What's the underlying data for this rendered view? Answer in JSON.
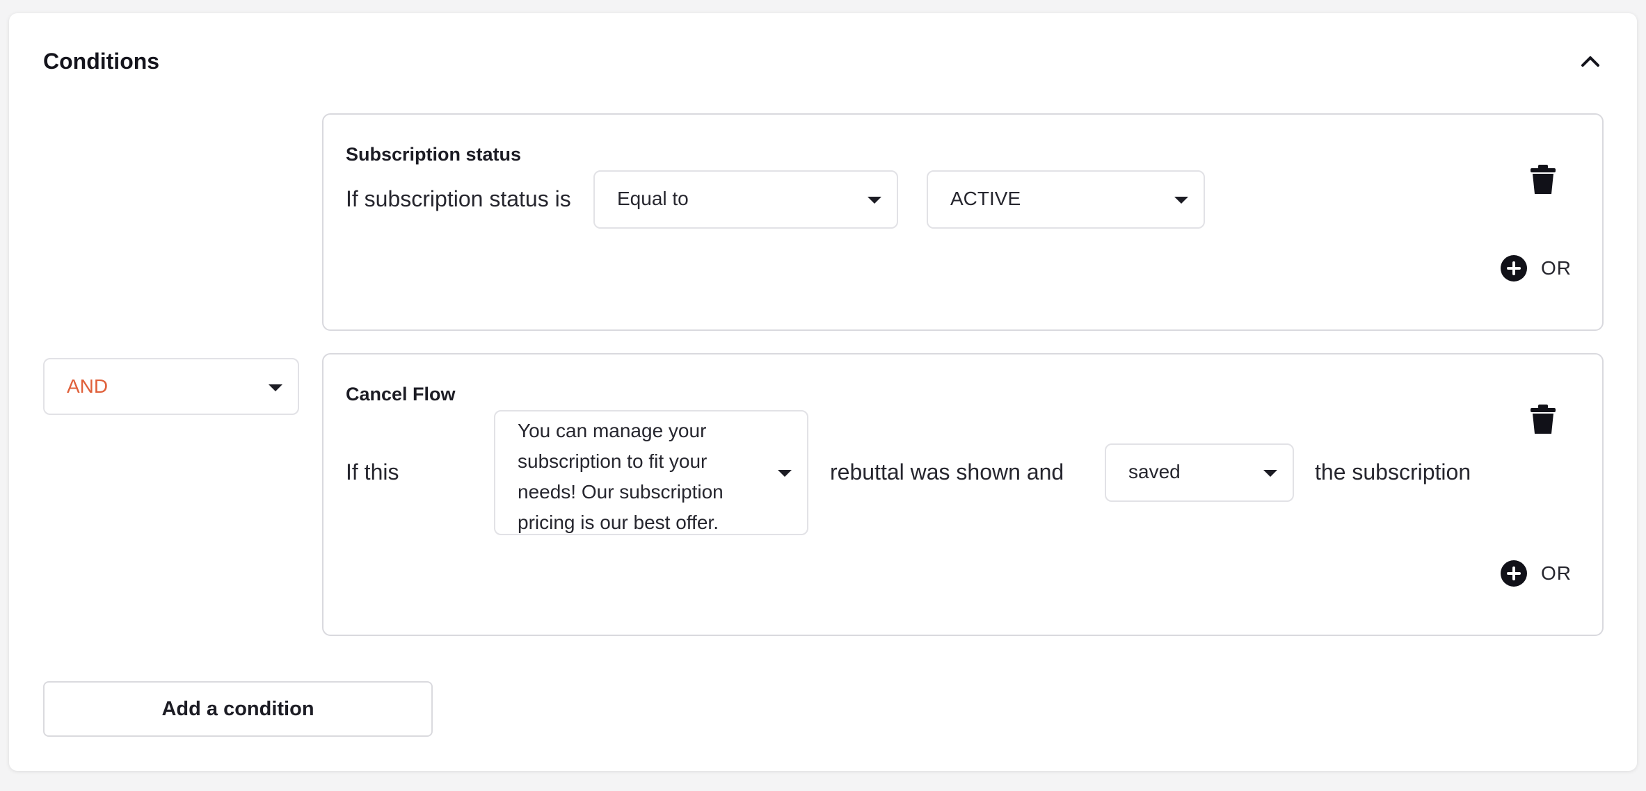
{
  "section": {
    "title": "Conditions",
    "collapse_icon": "chevron-up-icon"
  },
  "conditions": [
    {
      "title": "Subscription status",
      "prefix": "If subscription status is",
      "operator": "Equal to",
      "value": "ACTIVE",
      "or_label": "OR"
    },
    {
      "title": "Cancel Flow",
      "prefix": "If this",
      "rebuttal": "You can manage your subscription to fit your needs! Our subscription pricing is our best offer.",
      "middle": "rebuttal was shown and",
      "outcome": "saved",
      "suffix": "the subscription",
      "or_label": "OR"
    }
  ],
  "joiner": {
    "value": "AND",
    "color": "#e0603a"
  },
  "actions": {
    "add_condition_label": "Add a condition"
  }
}
